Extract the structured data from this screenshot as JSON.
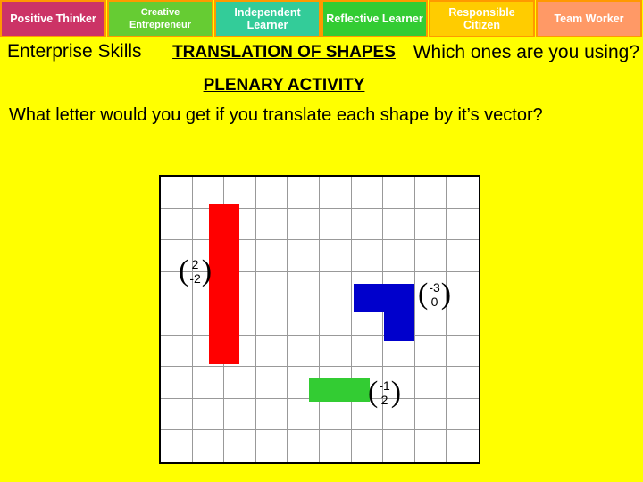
{
  "skills": [
    {
      "label": "Positive Thinker"
    },
    {
      "label": "Creative Entrepreneur"
    },
    {
      "label": "Independent Learner"
    },
    {
      "label": "Reflective Learner"
    },
    {
      "label": "Responsible Citizen"
    },
    {
      "label": "Team Worker"
    }
  ],
  "headings": {
    "enterprise_skills": "Enterprise Skills",
    "translation_title": "TRANSLATION OF SHAPES",
    "plenary_title": "PLENARY ACTIVITY",
    "which_ones": "Which ones are you using?"
  },
  "question": "What letter would you get if you translate each shape by it’s vector?",
  "grid": {
    "columns": 10,
    "rows": 9
  },
  "shapes": [
    {
      "name": "red-shape",
      "color": "#ff0000",
      "vector": {
        "x": "2",
        "y": "-2"
      }
    },
    {
      "name": "blue-shape",
      "color": "#0000cc",
      "vector": {
        "x": "-3",
        "y": "0"
      }
    },
    {
      "name": "green-shape",
      "color": "#33cc33",
      "vector": {
        "x": "-1",
        "y": "2"
      }
    }
  ]
}
